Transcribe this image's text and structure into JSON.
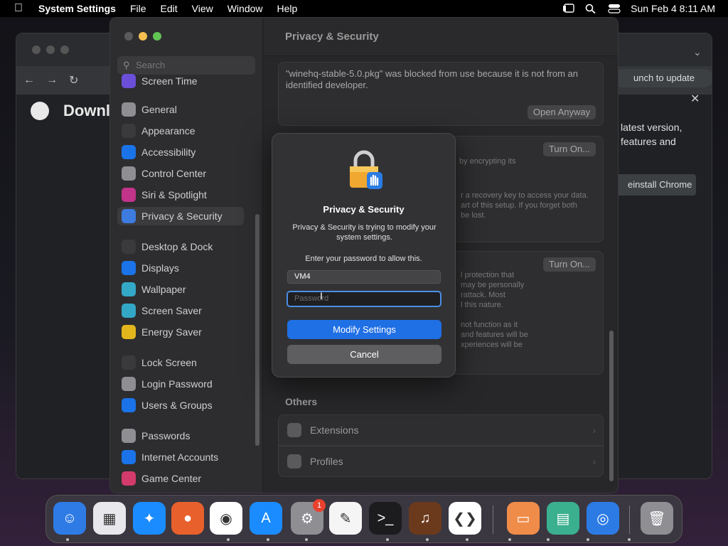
{
  "menubar": {
    "app_name": "System Settings",
    "menus": [
      "File",
      "Edit",
      "View",
      "Window",
      "Help"
    ],
    "clock": "Sun Feb 4  8:11 AM"
  },
  "chrome": {
    "page_title": "Downl",
    "relaunch_label": "unch to update",
    "line1": "latest version,",
    "line2": "features and",
    "reinstall_label": "einstall Chrome"
  },
  "settings": {
    "search_placeholder": "Search",
    "section_title": "Privacy & Security",
    "sidebar_items": [
      {
        "label": "Screen Time",
        "color": "#6b4fd8"
      },
      {
        "label": "General",
        "color": "#8e8e93"
      },
      {
        "label": "Appearance",
        "color": "#3a3a3c"
      },
      {
        "label": "Accessibility",
        "color": "#1a73e8"
      },
      {
        "label": "Control Center",
        "color": "#8e8e93"
      },
      {
        "label": "Siri & Spotlight",
        "color": "#c2338a"
      },
      {
        "label": "Privacy & Security",
        "color": "#3d7be0"
      },
      {
        "label": "Desktop & Dock",
        "color": "#3a3a3c"
      },
      {
        "label": "Displays",
        "color": "#1a73e8"
      },
      {
        "label": "Wallpaper",
        "color": "#34a8c7"
      },
      {
        "label": "Screen Saver",
        "color": "#33a7c6"
      },
      {
        "label": "Energy Saver",
        "color": "#e3b51d"
      },
      {
        "label": "Lock Screen",
        "color": "#3a3a3c"
      },
      {
        "label": "Login Password",
        "color": "#8e8e93"
      },
      {
        "label": "Users & Groups",
        "color": "#1a73e8"
      },
      {
        "label": "Passwords",
        "color": "#8e8e93"
      },
      {
        "label": "Internet Accounts",
        "color": "#1a73e8"
      },
      {
        "label": "Game Center",
        "color": "#d23b6b"
      }
    ],
    "blocked_message": "\"winehq-stable-5.0.pkg\" was blocked from use because it is not from an identified developer.",
    "open_anyway": "Open Anyway",
    "turn_on_1": "Turn On...",
    "turn_on_2": "Turn On...",
    "filevault_text": "by encrypting its",
    "filevault_text2": "r a recovery key to access your data.",
    "filevault_text3": "art of this setup. If you forget both",
    "filevault_text4": "be lost.",
    "lockdown_text1": "l protection that",
    "lockdown_text2": "may be personally",
    "lockdown_text3": "rattack. Most",
    "lockdown_text4": "l this nature.",
    "lockdown_text5": "not function as it",
    "lockdown_text6": "and features will be",
    "lockdown_text7": "xperiences will be",
    "others_title": "Others",
    "others_items": [
      "Extensions",
      "Profiles"
    ]
  },
  "dialog": {
    "title": "Privacy & Security",
    "message": "Privacy & Security is trying to modify your system settings.",
    "prompt": "Enter your password to allow this.",
    "username": "VM4",
    "password_placeholder": "Password",
    "primary_button": "Modify Settings",
    "cancel_button": "Cancel"
  },
  "dock": {
    "apps": [
      {
        "name": "Finder",
        "color": "#2e7be6",
        "glyph": "☺"
      },
      {
        "name": "Launchpad",
        "color": "#e8e8ec",
        "glyph": "▦"
      },
      {
        "name": "Safari",
        "color": "#1a8cff",
        "glyph": "✦"
      },
      {
        "name": "Firefox",
        "color": "#e8602c",
        "glyph": "●"
      },
      {
        "name": "Chrome",
        "color": "#ffffff",
        "glyph": "◉"
      },
      {
        "name": "App Store",
        "color": "#1a8cff",
        "glyph": "A"
      },
      {
        "name": "System Settings",
        "color": "#8e8e93",
        "glyph": "⚙"
      },
      {
        "name": "TextEdit",
        "color": "#f5f5f5",
        "glyph": "✎"
      },
      {
        "name": "Terminal",
        "color": "#1c1c1e",
        "glyph": ">_"
      },
      {
        "name": "GarageBand",
        "color": "#6b3a1c",
        "glyph": "♫"
      },
      {
        "name": "VS Code",
        "color": "#ffffff",
        "glyph": "❮❯"
      },
      {
        "name": "Remote Desktop",
        "color": "#f08c4a",
        "glyph": "▭"
      },
      {
        "name": "Archive",
        "color": "#3bb08f",
        "glyph": "▤"
      },
      {
        "name": "Screen Recorder",
        "color": "#2c7be5",
        "glyph": "◎"
      },
      {
        "name": "Trash",
        "color": "#8e8e93",
        "glyph": "🗑"
      }
    ],
    "settings_badge": "1"
  }
}
